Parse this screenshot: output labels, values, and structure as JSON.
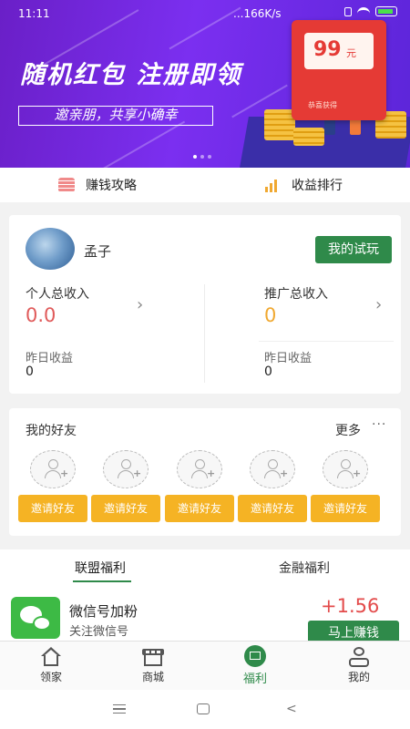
{
  "status_bar": {
    "time": "11:11",
    "speed": "...166K/s"
  },
  "banner": {
    "title": "随机红包 注册即领",
    "subtitle": "邀亲朋，共享小确幸",
    "envelope_amount": "99",
    "envelope_unit": "元",
    "envelope_caption": "恭喜获得",
    "accent_color": "#7b2ff0"
  },
  "quick_links": [
    {
      "label": "赚钱攻略",
      "icon": "coin-stack-icon"
    },
    {
      "label": "收益排行",
      "icon": "ranking-chart-icon"
    }
  ],
  "profile": {
    "username": "孟子",
    "trial_button": "我的试玩",
    "personal_income_label": "个人总收入",
    "personal_income_value": "0.0",
    "promo_income_label": "推广总收入",
    "promo_income_value": "0",
    "yesterday_label_left": "昨日收益",
    "yesterday_value_left": "0",
    "yesterday_label_right": "昨日收益",
    "yesterday_value_right": "0"
  },
  "friends": {
    "title": "我的好友",
    "more": "更多",
    "invite_labels": [
      "邀请好友",
      "邀请好友",
      "邀请好友",
      "邀请好友",
      "邀请好友"
    ]
  },
  "welfare": {
    "tabs": [
      "联盟福利",
      "金融福利"
    ],
    "task": {
      "title": "微信号加粉",
      "desc": "关注微信号",
      "reward": "+1.56",
      "button": "马上赚钱",
      "icon": "wechat-icon"
    }
  },
  "bottom_nav": [
    {
      "label": "领家",
      "icon": "home-icon"
    },
    {
      "label": "商城",
      "icon": "shop-icon"
    },
    {
      "label": "福利",
      "icon": "welfare-icon",
      "active": true
    },
    {
      "label": "我的",
      "icon": "profile-icon"
    }
  ],
  "colors": {
    "primary_green": "#2f8a4a",
    "invite_orange": "#f5b324",
    "income_red": "#e05a5a",
    "promo_orange": "#f0a830",
    "reward_red": "#e34b4b"
  }
}
